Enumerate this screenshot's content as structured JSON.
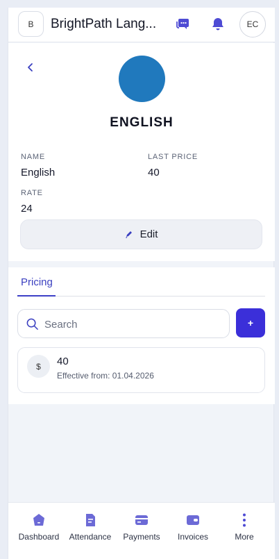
{
  "header": {
    "brand_initial": "B",
    "title": "BrightPath Lang...",
    "user_initials": "EC"
  },
  "profile": {
    "subject_title": "ENGLISH",
    "fields": {
      "name_label": "NAME",
      "name_value": "English",
      "last_price_label": "LAST PRICE",
      "last_price_value": "40",
      "rate_label": "RATE",
      "rate_value": "24"
    },
    "edit_label": "Edit",
    "avatar_color": "#2079bd"
  },
  "pricing": {
    "tab_label": "Pricing",
    "search_placeholder": "Search",
    "add_label": "+",
    "items": [
      {
        "symbol": "$",
        "value": "40",
        "effective": "Effective from: 01.04.2026"
      }
    ]
  },
  "nav": {
    "items": [
      {
        "label": "Dashboard",
        "icon": "dashboard-icon"
      },
      {
        "label": "Attendance",
        "icon": "attendance-icon"
      },
      {
        "label": "Payments",
        "icon": "payments-icon"
      },
      {
        "label": "Invoices",
        "icon": "invoices-icon"
      },
      {
        "label": "More",
        "icon": "more-icon"
      }
    ]
  },
  "colors": {
    "accent": "#3b2fd9",
    "tab_active": "#3a3fc0",
    "nav_icon": "#6c6ad6"
  }
}
